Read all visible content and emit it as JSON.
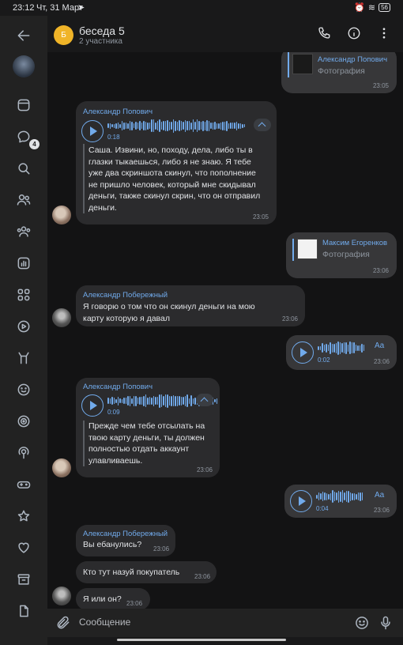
{
  "status_bar": {
    "time": "23:12",
    "date": "Чт, 31 Март",
    "battery": "56"
  },
  "rail": {
    "badge_count": "4"
  },
  "header": {
    "avatar_letter": "Б",
    "title": "беседа 5",
    "subtitle": "2 участника"
  },
  "messages": {
    "fwd1": {
      "name": "Александр Попович",
      "kind": "Фотография",
      "time": "23:05"
    },
    "voice1": {
      "sender": "Александр Попович",
      "duration": "0:18",
      "transcript": [
        "Саша. Извини, но, походу, дела, либо ты в",
        "глазки тыкаешься, либо я не знаю. Я тебе",
        "уже два скриншота скинул, что пополнение",
        "не пришло человек, который мне скидывал",
        "деньги, также скинул скрин, что он отправил",
        "деньги."
      ],
      "time": "23:05"
    },
    "fwd2": {
      "name": "Максим Егоренков",
      "kind": "Фотография",
      "time": "23:06"
    },
    "text1": {
      "sender": "Александр Побережный",
      "lines": [
        "Я говорю о том что он скинул деньги на мою",
        "карту которую я давал"
      ],
      "time": "23:06"
    },
    "voice_out1": {
      "duration": "0:02",
      "aa": "Aa",
      "time": "23:06"
    },
    "voice2": {
      "sender": "Александр Попович",
      "duration": "0:09",
      "transcript": [
        "Прежде чем тебе отсылать на",
        "твою карту деньги, ты должен",
        "полностью отдать аккаунт",
        "улавливаешь."
      ],
      "time": "23:06"
    },
    "voice_out2": {
      "duration": "0:04",
      "aa": "Aa",
      "time": "23:06"
    },
    "text2": {
      "sender": "Александр Побережный",
      "text": "Вы ебанулись?",
      "time": "23:06"
    },
    "text3": {
      "text": "Кто тут назуй покупатель",
      "time": "23:06"
    },
    "text4": {
      "text": "Я или он?",
      "time": "23:06"
    }
  },
  "composer": {
    "placeholder": "Сообщение"
  },
  "colors": {
    "accent": "#71aaeb",
    "bubble_in": "#2b2b2d",
    "bubble_out": "#373739",
    "background": "#131314"
  }
}
